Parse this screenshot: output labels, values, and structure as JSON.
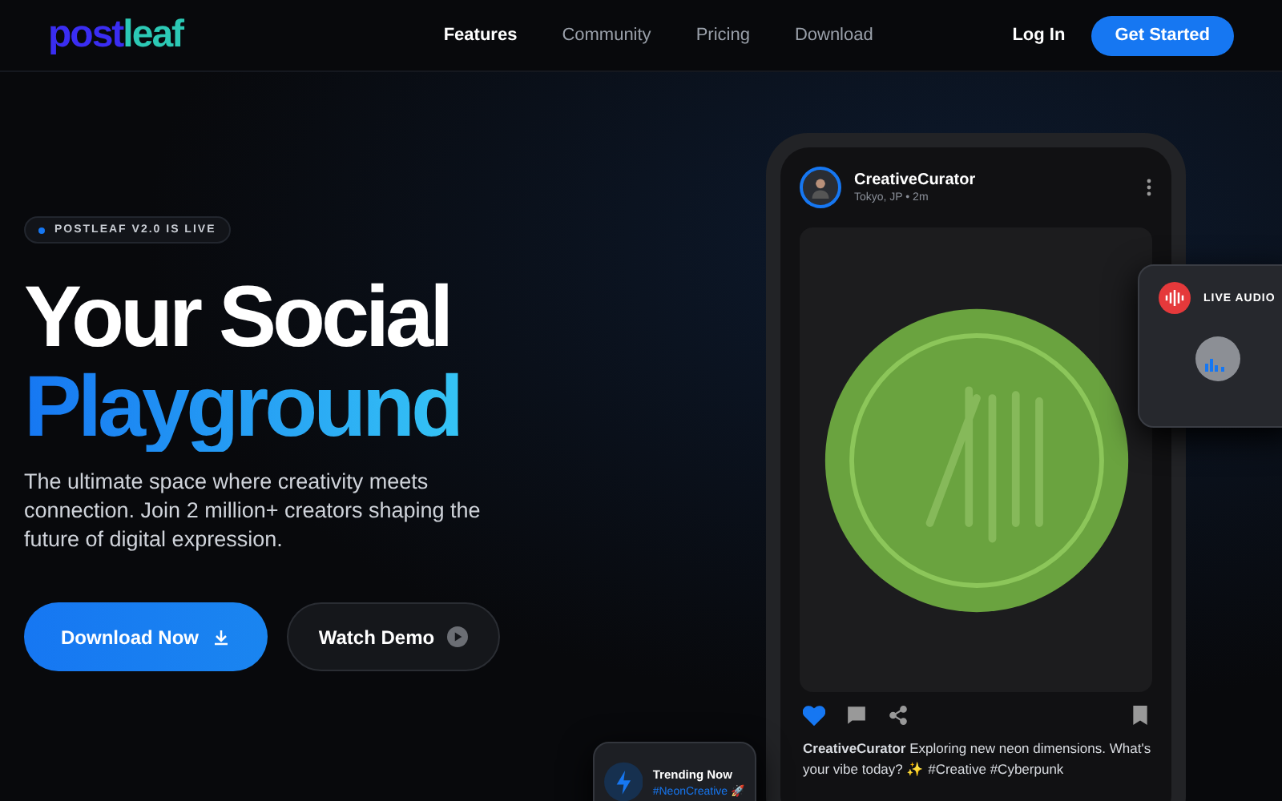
{
  "header": {
    "logo": {
      "part_1": "post",
      "part_2": "leaf"
    },
    "nav": [
      {
        "label": "Features",
        "selected": true
      },
      {
        "label": "Community",
        "selected": false
      },
      {
        "label": "Pricing",
        "selected": false
      },
      {
        "label": "Download",
        "selected": false
      }
    ],
    "login": "Log In",
    "cta": "Get Started"
  },
  "hero": {
    "badge": "POSTLEAF V2.0 IS LIVE",
    "title_line_1": "Your Social",
    "title_line_2": "Playground",
    "description": "The ultimate space where creativity meets connection. Join 2 million+ creators shaping the future of digital expression.",
    "primary_button": "Download Now",
    "secondary_button": "Watch Demo"
  },
  "post": {
    "author": "CreativeCurator",
    "meta": "Tokyo, JP • 2m",
    "liked": true,
    "caption": "**CreativeCurator** Exploring new neon dimensions. What's your vibe today? ✨ #Creative #Cyberpunk"
  },
  "live_audio": {
    "label": "LIVE AUDIO"
  },
  "trending": {
    "title": "Trending Now",
    "tag": "#NeonCreative 🚀"
  }
}
